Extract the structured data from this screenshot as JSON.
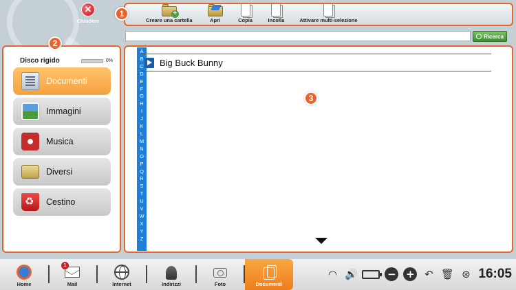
{
  "header": {
    "close_label": "Chiudere",
    "badges": [
      "1",
      "2",
      "3"
    ]
  },
  "toolbar": {
    "items": [
      {
        "label": "Creare una cartella",
        "icon": "new-folder-icon"
      },
      {
        "label": "Apri",
        "icon": "open-folder-icon"
      },
      {
        "label": "Copia",
        "icon": "copy-icon"
      },
      {
        "label": "Incolla",
        "icon": "paste-icon"
      },
      {
        "label": "Attivare multi-selezione",
        "icon": "multi-select-icon"
      }
    ]
  },
  "search": {
    "value": "",
    "button_label": "Ricerca"
  },
  "sidebar": {
    "disk_label": "Disco rigido",
    "disk_usage": "0%",
    "disk_usage_fraction": 0,
    "categories": [
      {
        "label": "Documenti",
        "icon": "documents-icon",
        "active": true
      },
      {
        "label": "Immagini",
        "icon": "images-icon",
        "active": false
      },
      {
        "label": "Musica",
        "icon": "music-icon",
        "active": false
      },
      {
        "label": "Diversi",
        "icon": "folder-icon",
        "active": false
      },
      {
        "label": "Cestino",
        "icon": "trash-icon",
        "active": false
      }
    ]
  },
  "main": {
    "alphabet": [
      "A",
      "B",
      "C",
      "D",
      "E",
      "F",
      "G",
      "H",
      "I",
      "J",
      "K",
      "L",
      "M",
      "N",
      "O",
      "P",
      "Q",
      "R",
      "S",
      "T",
      "U",
      "V",
      "W",
      "X",
      "Y",
      "Z"
    ],
    "files": [
      {
        "name": "Big Buck Bunny",
        "icon": "video-file-icon"
      }
    ]
  },
  "taskbar": {
    "items": [
      {
        "label": "Home",
        "icon": "home-icon"
      },
      {
        "label": "Mail",
        "icon": "mail-icon",
        "badge": "1"
      },
      {
        "label": "Internet",
        "icon": "globe-icon"
      },
      {
        "label": "Indirizzi",
        "icon": "contacts-icon"
      },
      {
        "label": "Foto",
        "icon": "camera-icon"
      },
      {
        "label": "Documenti",
        "icon": "documents-icon",
        "active": true
      }
    ],
    "clock": "16:05"
  },
  "colors": {
    "accent_orange": "#e8642c",
    "active_item": "#f5a13d",
    "alphabet_bar": "#1e7fd8",
    "search_button": "#4fa63f",
    "close_red": "#c0141c"
  }
}
